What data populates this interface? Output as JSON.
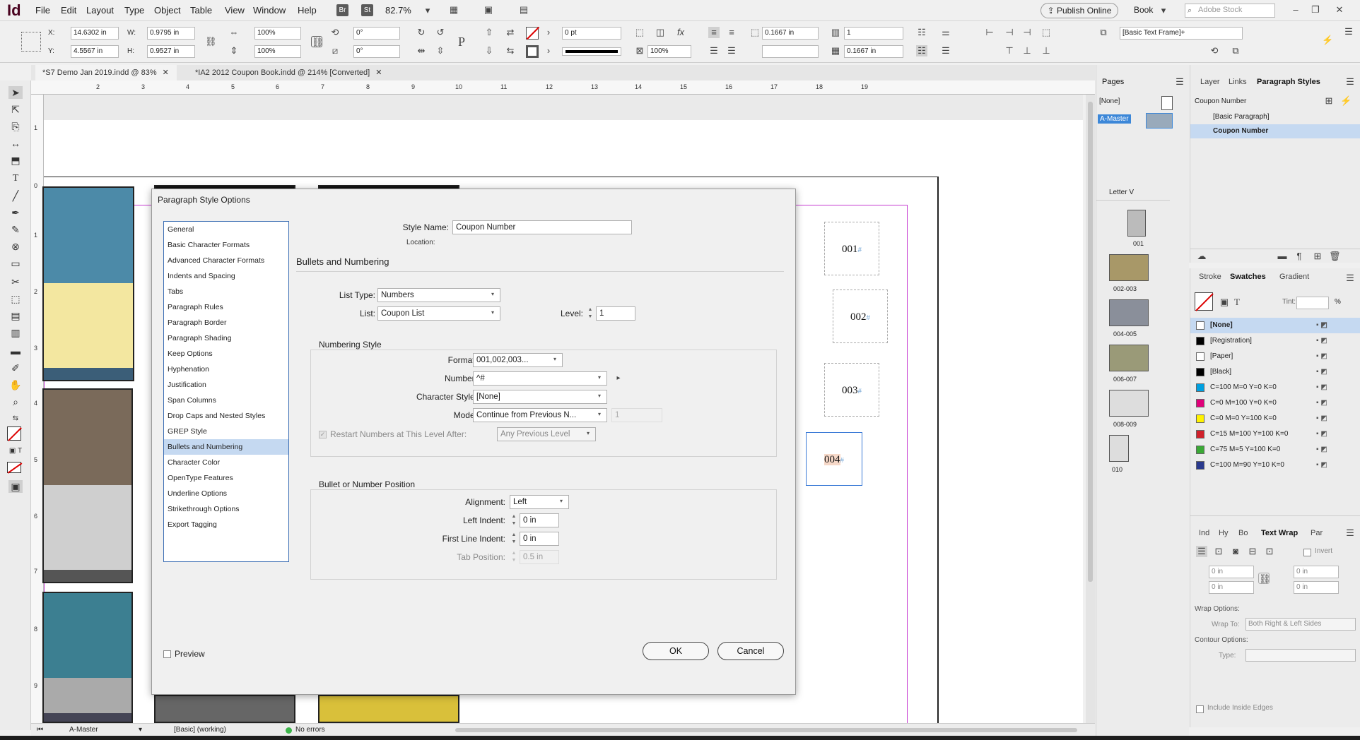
{
  "app": {
    "logo": "Id",
    "bridge": "Br",
    "stock_badge": "St",
    "zoom": "82.7%",
    "publish_online": "Publish Online",
    "workspace": "Book",
    "search_placeholder": "Adobe Stock"
  },
  "menu": [
    "File",
    "Edit",
    "Layout",
    "Type",
    "Object",
    "Table",
    "View",
    "Window",
    "Help"
  ],
  "control": {
    "x_label": "X:",
    "x": "14.6302 in",
    "y_label": "Y:",
    "y": "4.5567 in",
    "w_label": "W:",
    "w": "0.9795 in",
    "h_label": "H:",
    "h": "0.9527 in",
    "scale_x": "100%",
    "scale_y": "100%",
    "rotate": "0°",
    "shear": "0°",
    "stroke_weight": "0 pt",
    "percent": "100%",
    "gap": "0.1667 in",
    "gap2": "0.1667 in",
    "columns": "1",
    "frame_style": "[Basic Text Frame]+"
  },
  "tabs": [
    {
      "label": "*S7 Demo Jan 2019.indd @ 83%"
    },
    {
      "label": "*IA2 2012 Coupon Book.indd @ 214% [Converted]"
    }
  ],
  "ruler_h": [
    "2",
    "3",
    "4",
    "5",
    "6",
    "7",
    "8",
    "9",
    "10",
    "11",
    "12",
    "13",
    "14",
    "15",
    "16",
    "17",
    "18",
    "19"
  ],
  "ruler_v": [
    "1",
    "0",
    "1",
    "2",
    "3",
    "4",
    "5",
    "6",
    "7",
    "8",
    "9"
  ],
  "coupons": [
    "001",
    "002",
    "003",
    "004"
  ],
  "dialog": {
    "title": "Paragraph Style Options",
    "categories": [
      "General",
      "Basic Character Formats",
      "Advanced Character Formats",
      "Indents and Spacing",
      "Tabs",
      "Paragraph Rules",
      "Paragraph Border",
      "Paragraph Shading",
      "Keep Options",
      "Hyphenation",
      "Justification",
      "Span Columns",
      "Drop Caps and Nested Styles",
      "GREP Style",
      "Bullets and Numbering",
      "Character Color",
      "OpenType Features",
      "Underline Options",
      "Strikethrough Options",
      "Export Tagging"
    ],
    "style_name_label": "Style Name:",
    "style_name": "Coupon Number",
    "location_label": "Location:",
    "section_title": "Bullets and Numbering",
    "list_type_label": "List Type:",
    "list_type": "Numbers",
    "list_label": "List:",
    "list": "Coupon List",
    "level_label": "Level:",
    "level": "1",
    "numbering_style_title": "Numbering Style",
    "format_label": "Format:",
    "format": "001,002,003...",
    "number_label": "Number:",
    "number": "^#",
    "char_style_label": "Character Style:",
    "char_style": "[None]",
    "mode_label": "Mode:",
    "mode": "Continue from Previous N...",
    "mode_value": "1",
    "restart_label": "Restart Numbers at This Level After:",
    "restart_value": "Any Previous Level",
    "position_title": "Bullet or Number Position",
    "alignment_label": "Alignment:",
    "alignment": "Left",
    "left_indent_label": "Left Indent:",
    "left_indent": "0 in",
    "first_line_label": "First Line Indent:",
    "first_line": "0 in",
    "tab_position_label": "Tab Position:",
    "tab_position": "0.5 in",
    "preview_label": "Preview",
    "ok": "OK",
    "cancel": "Cancel"
  },
  "pages_panel": {
    "title": "Pages",
    "none": "[None]",
    "master": "A-Master",
    "page_size": "Letter V",
    "spreads": [
      "001",
      "002-003",
      "004-005",
      "006-007",
      "008-009",
      "010"
    ]
  },
  "para_styles_panel": {
    "tabs": [
      "Layer",
      "Links",
      "Paragraph Styles"
    ],
    "current": "Coupon Number",
    "items": [
      "[Basic Paragraph]",
      "Coupon Number"
    ]
  },
  "swatches_panel": {
    "tabs": [
      "Stroke",
      "Swatches",
      "Gradient"
    ],
    "tint_label": "Tint:",
    "tint_unit": "%",
    "items": [
      {
        "name": "[None]",
        "color": "#ffffff"
      },
      {
        "name": "[Registration]",
        "color": "#000000"
      },
      {
        "name": "[Paper]",
        "color": "#ffffff"
      },
      {
        "name": "[Black]",
        "color": "#000000"
      },
      {
        "name": "C=100 M=0 Y=0 K=0",
        "color": "#00a0e0"
      },
      {
        "name": "C=0 M=100 Y=0 K=0",
        "color": "#e0007a"
      },
      {
        "name": "C=0 M=0 Y=100 K=0",
        "color": "#fff200"
      },
      {
        "name": "C=15 M=100 Y=100 K=0",
        "color": "#d0202a"
      },
      {
        "name": "C=75 M=5 Y=100 K=0",
        "color": "#3aa935"
      },
      {
        "name": "C=100 M=90 Y=10 K=0",
        "color": "#2a3a8e"
      }
    ]
  },
  "wrap_panel": {
    "tabs": [
      "Ind",
      "Hy",
      "Bo",
      "Text Wrap",
      "Par"
    ],
    "invert": "Invert",
    "top": "0 in",
    "bottom": "0 in",
    "left": "0 in",
    "right": "0 in",
    "wrap_options": "Wrap Options:",
    "wrap_to_label": "Wrap To:",
    "wrap_to": "Both Right & Left Sides",
    "contour_options": "Contour Options:",
    "type_label": "Type:",
    "include_inside": "Include Inside Edges"
  },
  "status": {
    "page": "A-Master",
    "profile": "[Basic] (working)",
    "errors": "No errors"
  }
}
